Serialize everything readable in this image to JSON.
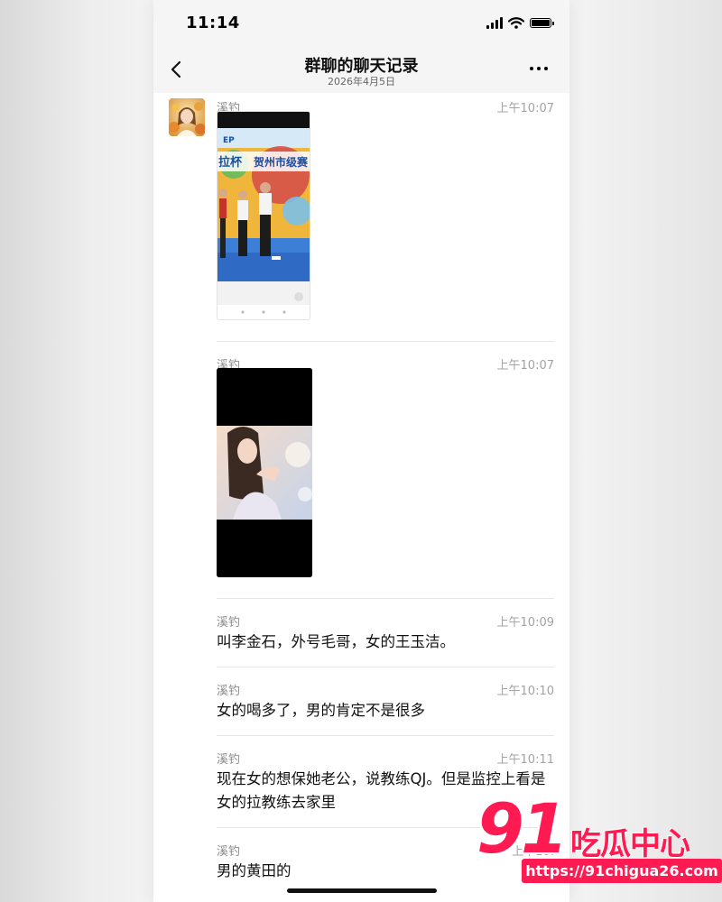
{
  "status_bar": {
    "time": "11:14"
  },
  "header": {
    "title": "群聊的聊天记录",
    "date": "2026年4月5日",
    "back_icon": "chevron-left-icon",
    "more_icon": "ellipsis-icon"
  },
  "messages": [
    {
      "sender": "溪钓",
      "time": "上午10:07",
      "type": "image",
      "image_text": [
        "拉杯",
        "贺州市级赛"
      ]
    },
    {
      "sender": "溪钓",
      "time": "上午10:07",
      "type": "image"
    },
    {
      "sender": "溪钓",
      "time": "上午10:09",
      "text": "叫李金石，外号毛哥，女的王玉洁。"
    },
    {
      "sender": "溪钓",
      "time": "上午10:10",
      "text": "女的喝多了，男的肯定不是很多"
    },
    {
      "sender": "溪钓",
      "time": "上午10:11",
      "text": "现在女的想保她老公，说教练QJ。但是监控上看是女的拉教练去家里"
    },
    {
      "sender": "溪钓",
      "time": "上午10:",
      "text": "男的黄田的"
    }
  ],
  "watermark": {
    "number": "91",
    "name": "吃瓜中心",
    "url": "https://91chigua26.com"
  },
  "colors": {
    "accent": "#ff1b52",
    "header_bg": "#f5f5f5"
  }
}
